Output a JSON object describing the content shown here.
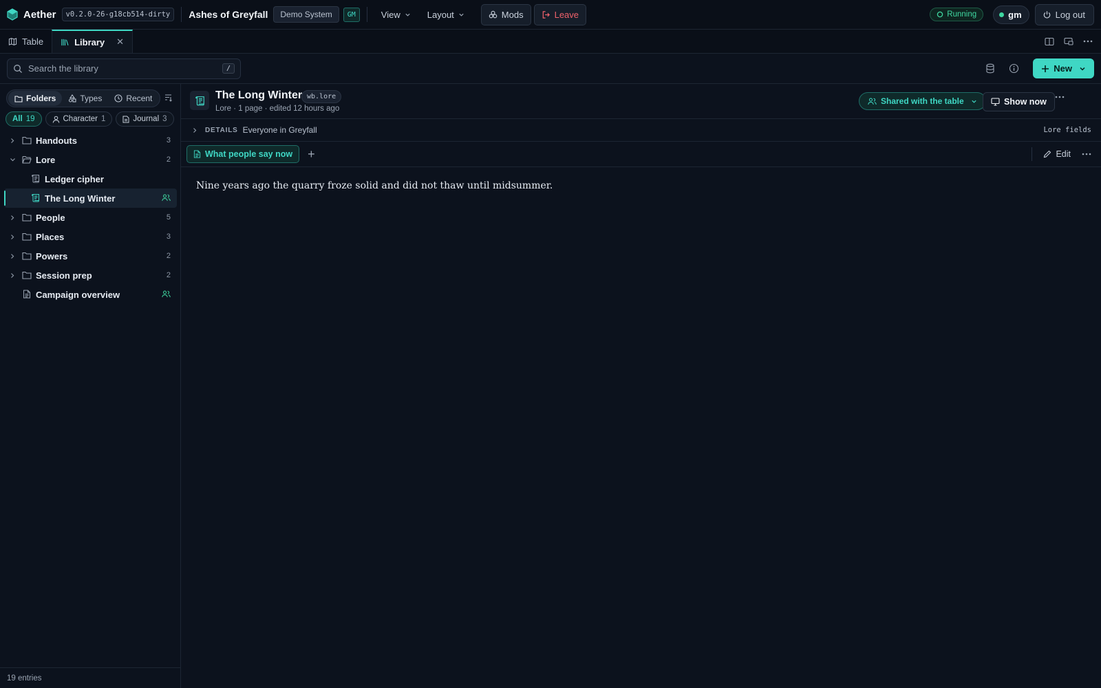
{
  "app": {
    "name": "Aether",
    "version": "v0.2.0-26-g18cb514-dirty",
    "campaign": "Ashes of Greyfall",
    "system": "Demo System",
    "role_badge": "GM"
  },
  "menu": {
    "view": "View",
    "layout": "Layout",
    "mods": "Mods",
    "leave": "Leave"
  },
  "status": {
    "running": "Running",
    "user": "gm",
    "logout": "Log out"
  },
  "tabs": [
    {
      "label": "Table"
    },
    {
      "label": "Library"
    }
  ],
  "toolbar": {
    "search_placeholder": "Search the library",
    "search_shortcut": "/",
    "new_label": "New"
  },
  "sidebar": {
    "modes": [
      {
        "label": "Folders"
      },
      {
        "label": "Types"
      },
      {
        "label": "Recent"
      }
    ],
    "filters": [
      {
        "label": "All",
        "count": "19"
      },
      {
        "label": "Character",
        "count": "1"
      },
      {
        "label": "Journal",
        "count": "3"
      }
    ],
    "tree": [
      {
        "label": "Handouts",
        "count": "3"
      },
      {
        "label": "Lore",
        "count": "2"
      },
      {
        "label": "Ledger cipher"
      },
      {
        "label": "The Long Winter"
      },
      {
        "label": "People",
        "count": "5"
      },
      {
        "label": "Places",
        "count": "3"
      },
      {
        "label": "Powers",
        "count": "2"
      },
      {
        "label": "Session prep",
        "count": "2"
      },
      {
        "label": "Campaign overview"
      }
    ],
    "footer": "19 entries"
  },
  "document": {
    "title": "The Long Winter",
    "type": "wb.lore",
    "meta": "Lore · 1 page · edited 12 hours ago",
    "shared_label": "Shared with the table",
    "show_label": "Show now",
    "details_key": "DETAILS",
    "details_value": "Everyone in Greyfall",
    "details_right": "Lore fields",
    "page_tab": "What people say now",
    "edit_label": "Edit",
    "body": "Nine years ago the quarry froze solid and did not thaw until midsummer."
  }
}
